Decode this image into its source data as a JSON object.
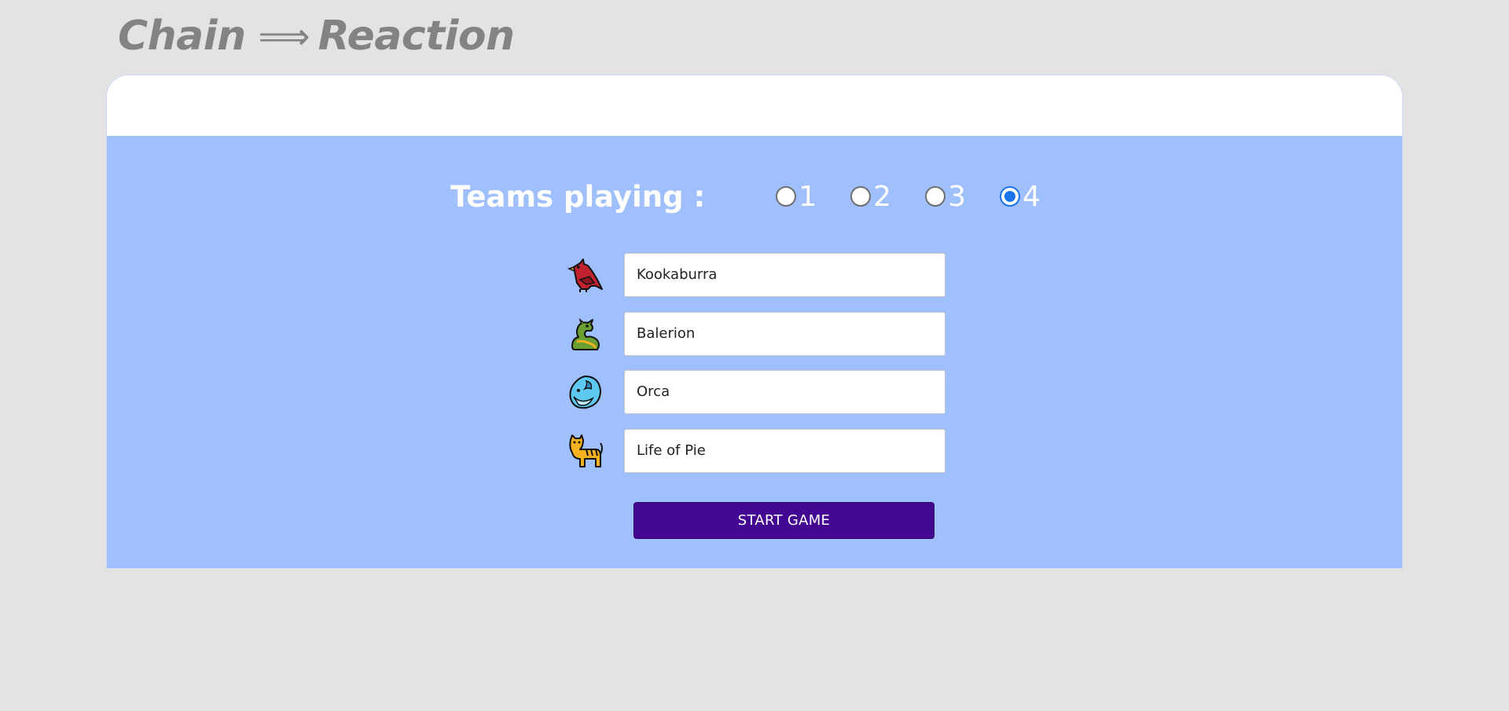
{
  "header": {
    "title_left": "Chain",
    "title_arrow": "⟹",
    "title_right": "Reaction"
  },
  "setup": {
    "teams_label": "Teams playing :",
    "team_count_options": [
      {
        "label": "1",
        "selected": false
      },
      {
        "label": "2",
        "selected": false
      },
      {
        "label": "3",
        "selected": false
      },
      {
        "label": "4",
        "selected": true
      }
    ],
    "teams": [
      {
        "icon": "bird-icon",
        "name": "Kookaburra",
        "color": "#c0232d"
      },
      {
        "icon": "dragon-icon",
        "name": "Balerion",
        "color": "#6aa032"
      },
      {
        "icon": "whale-icon",
        "name": "Orca",
        "color": "#5ec9f0"
      },
      {
        "icon": "tiger-icon",
        "name": "Life of Pie",
        "color": "#f6b11e"
      }
    ],
    "start_label": "START GAME"
  },
  "colors": {
    "background": "#e3e3e3",
    "card": "#a0c0fd",
    "start_button": "#440792",
    "radio_accent": "#1a73e8",
    "title": "#838383"
  }
}
